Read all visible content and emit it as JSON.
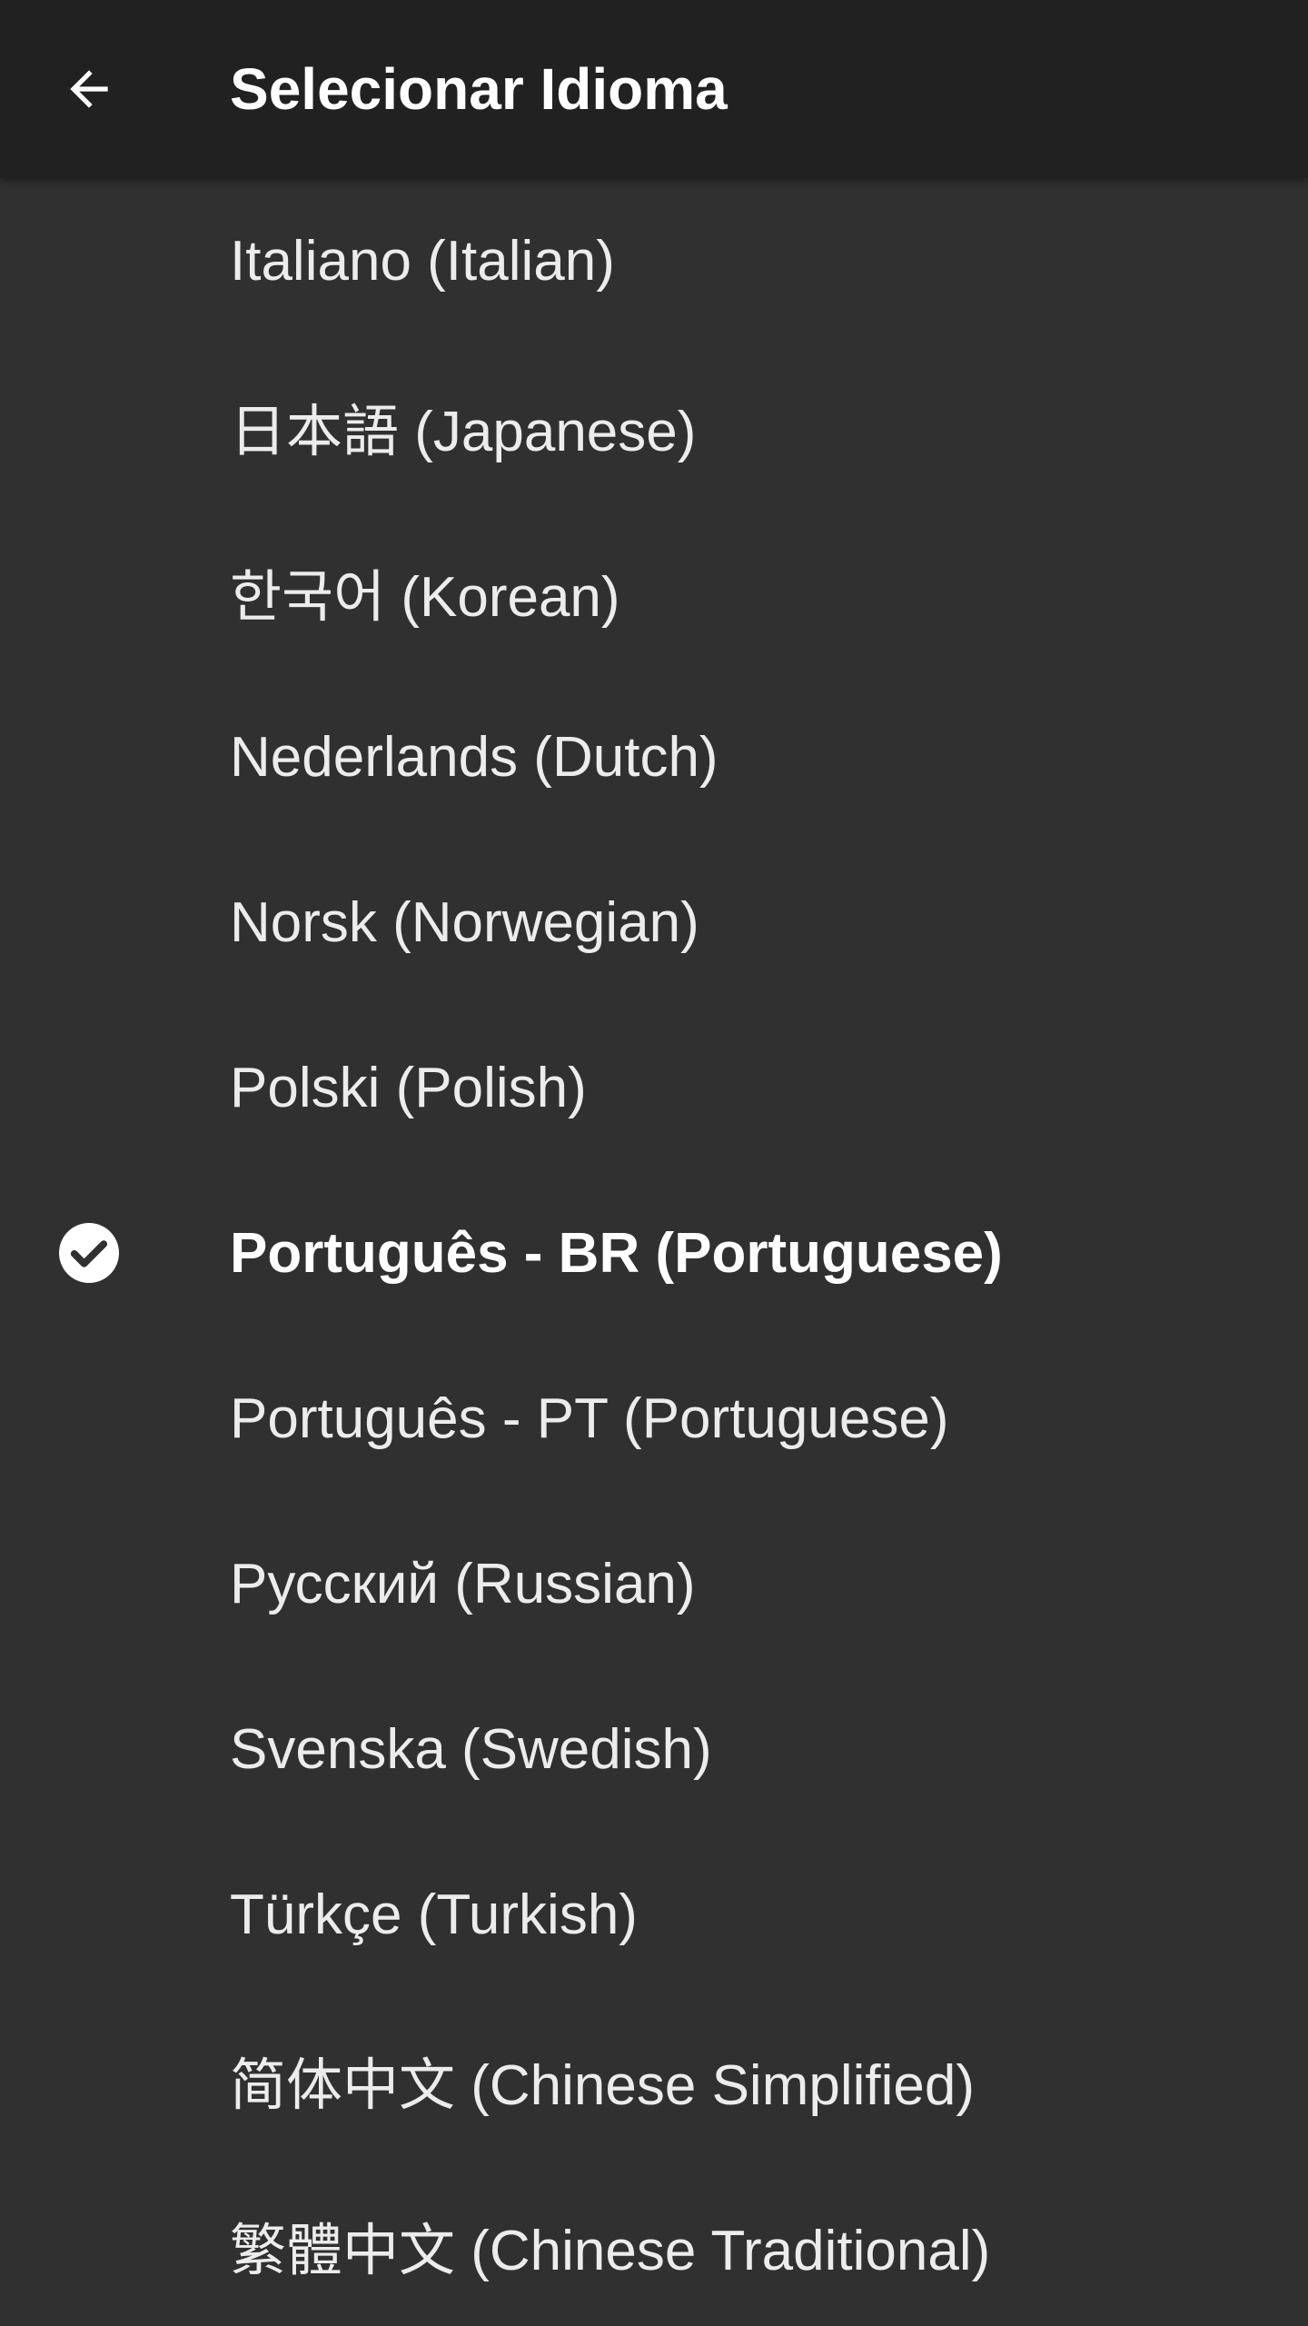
{
  "header": {
    "title": "Selecionar Idioma",
    "back_icon": "arrow-back-icon"
  },
  "languages": [
    {
      "label": "Italiano (Italian)",
      "selected": false
    },
    {
      "label": "日本語 (Japanese)",
      "selected": false
    },
    {
      "label": "한국어 (Korean)",
      "selected": false
    },
    {
      "label": "Nederlands (Dutch)",
      "selected": false
    },
    {
      "label": "Norsk (Norwegian)",
      "selected": false
    },
    {
      "label": "Polski (Polish)",
      "selected": false
    },
    {
      "label": "Português - BR (Portuguese)",
      "selected": true
    },
    {
      "label": "Português - PT (Portuguese)",
      "selected": false
    },
    {
      "label": "Русский (Russian)",
      "selected": false
    },
    {
      "label": "Svenska (Swedish)",
      "selected": false
    },
    {
      "label": "Türkçe (Turkish)",
      "selected": false
    },
    {
      "label": "简体中文 (Chinese Simplified)",
      "selected": false
    },
    {
      "label": "繁體中文 (Chinese Traditional)",
      "selected": false
    }
  ],
  "selected_icon": "check-circle-icon",
  "colors": {
    "app_bar": "#212121",
    "background": "#303030",
    "text": "#ffffff"
  }
}
